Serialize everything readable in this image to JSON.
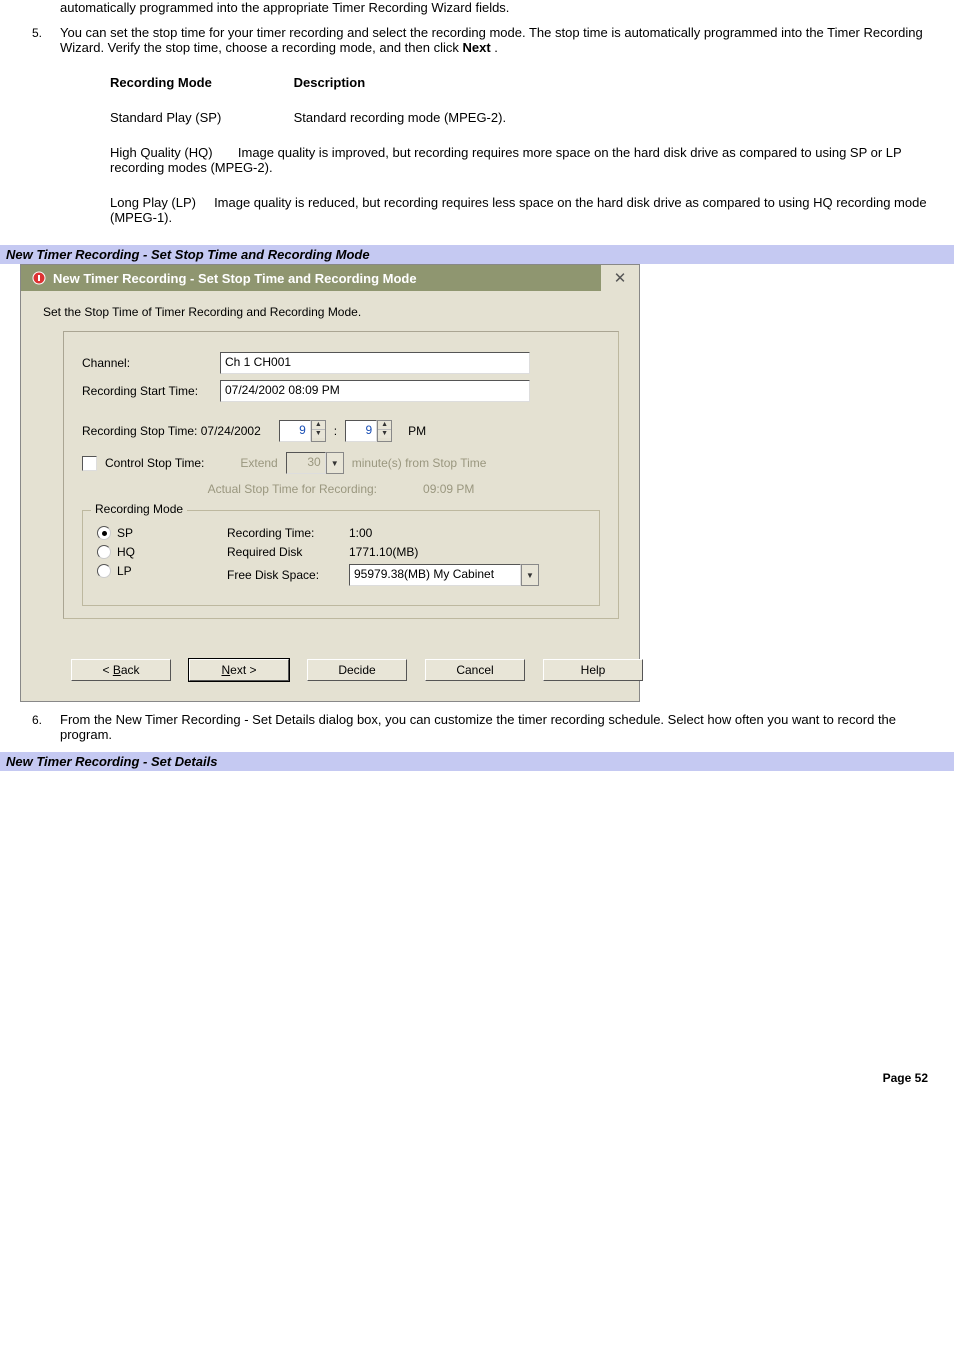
{
  "intro_continued": "automatically programmed into the appropriate Timer Recording Wizard fields.",
  "steps": {
    "s5": {
      "num": "5.",
      "text_before_bold": "You can set the stop time for your timer recording and select the recording mode. The stop time is automatically programmed into the Timer Recording Wizard. Verify the stop time, choose a recording mode, and then click ",
      "bold_word": "Next",
      "text_after_bold": " ."
    },
    "s6": {
      "num": "6.",
      "text": "From the New Timer Recording - Set Details dialog box, you can customize the timer recording schedule. Select how often you want to record the program."
    }
  },
  "table": {
    "header_mode": "Recording Mode",
    "header_desc": "Description",
    "rows": [
      {
        "mode": "Standard Play (SP)",
        "desc": "Standard recording mode (MPEG-2)."
      },
      {
        "mode": "High Quality (HQ)",
        "desc": "Image quality is improved, but recording requires more space on the hard disk drive as compared to using SP or LP recording modes (MPEG-2)."
      },
      {
        "mode": "Long Play (LP)",
        "desc": "Image quality is reduced, but recording requires less space on the hard disk drive as compared to using HQ recording mode (MPEG-1)."
      }
    ]
  },
  "captions": {
    "c1": "New Timer Recording - Set Stop Time and Recording Mode",
    "c2": "New Timer Recording - Set Details"
  },
  "dialog": {
    "title": "New Timer Recording - Set Stop Time and Recording Mode",
    "intro": "Set the Stop Time of Timer Recording and Recording Mode.",
    "channel_label": "Channel:",
    "channel_value": "Ch 1 CH001",
    "start_label": "Recording Start Time:",
    "start_value": "07/24/2002 08:09 PM",
    "stop_label": "Recording Stop Time: 07/24/2002",
    "stop_hour": "9",
    "stop_sep": ":",
    "stop_min": "9",
    "stop_ampm": "PM",
    "control_label": "Control Stop Time:",
    "extend_label": "Extend",
    "extend_value": "30",
    "extend_suffix": "minute(s) from Stop Time",
    "actual_label": "Actual Stop Time for Recording:",
    "actual_value": "09:09 PM",
    "group_legend": "Recording Mode",
    "radios": {
      "sp": "SP",
      "hq": "HQ",
      "lp": "LP"
    },
    "details": {
      "rec_time_label": "Recording Time:",
      "rec_time_value": "1:00",
      "req_label": "Required Disk",
      "req_value": "1771.10(MB)",
      "free_label": "Free Disk Space:",
      "free_value": "95979.38(MB) My Cabinet"
    },
    "buttons": {
      "back": "< Back",
      "back_u": "B",
      "next": "Next >",
      "next_u": "N",
      "decide": "Decide",
      "cancel": "Cancel",
      "help": "Help"
    }
  },
  "page_footer": "Page 52"
}
